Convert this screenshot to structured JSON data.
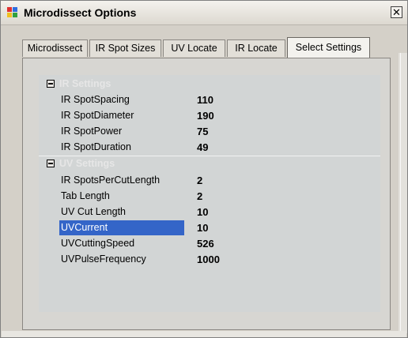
{
  "window": {
    "title": "Microdissect Options",
    "close_glyph": "✕",
    "app_icon": "window-icon",
    "icon_colors": [
      "#e03030",
      "#2e6de0",
      "#f0c020",
      "#30a040"
    ]
  },
  "tabs": [
    {
      "label": "Microdissect",
      "active": false
    },
    {
      "label": "IR Spot Sizes",
      "active": false
    },
    {
      "label": "UV Locate",
      "active": false
    },
    {
      "label": "IR Locate",
      "active": false
    },
    {
      "label": "Select Settings",
      "active": true
    }
  ],
  "groups": [
    {
      "label": "IR Settings",
      "expanded": true,
      "rows": [
        {
          "name": "IR SpotSpacing",
          "value": "110",
          "selected": false
        },
        {
          "name": "IR SpotDiameter",
          "value": "190",
          "selected": false
        },
        {
          "name": "IR SpotPower",
          "value": "75",
          "selected": false
        },
        {
          "name": "IR SpotDuration",
          "value": "49",
          "selected": false
        }
      ]
    },
    {
      "label": "UV Settings",
      "expanded": true,
      "rows": [
        {
          "name": "IR SpotsPerCutLength",
          "value": "2",
          "selected": false
        },
        {
          "name": "Tab Length",
          "value": "2",
          "selected": false
        },
        {
          "name": "UV Cut Length",
          "value": "10",
          "selected": false
        },
        {
          "name": "UVCurrent",
          "value": "10",
          "selected": true
        },
        {
          "name": "UVCuttingSpeed",
          "value": "526",
          "selected": false
        },
        {
          "name": "UVPulseFrequency",
          "value": "1000",
          "selected": false
        }
      ]
    }
  ],
  "colors": {
    "selection": "#3465c8",
    "group_label": "#e6e6e6",
    "panel": "#d2d5d5"
  }
}
